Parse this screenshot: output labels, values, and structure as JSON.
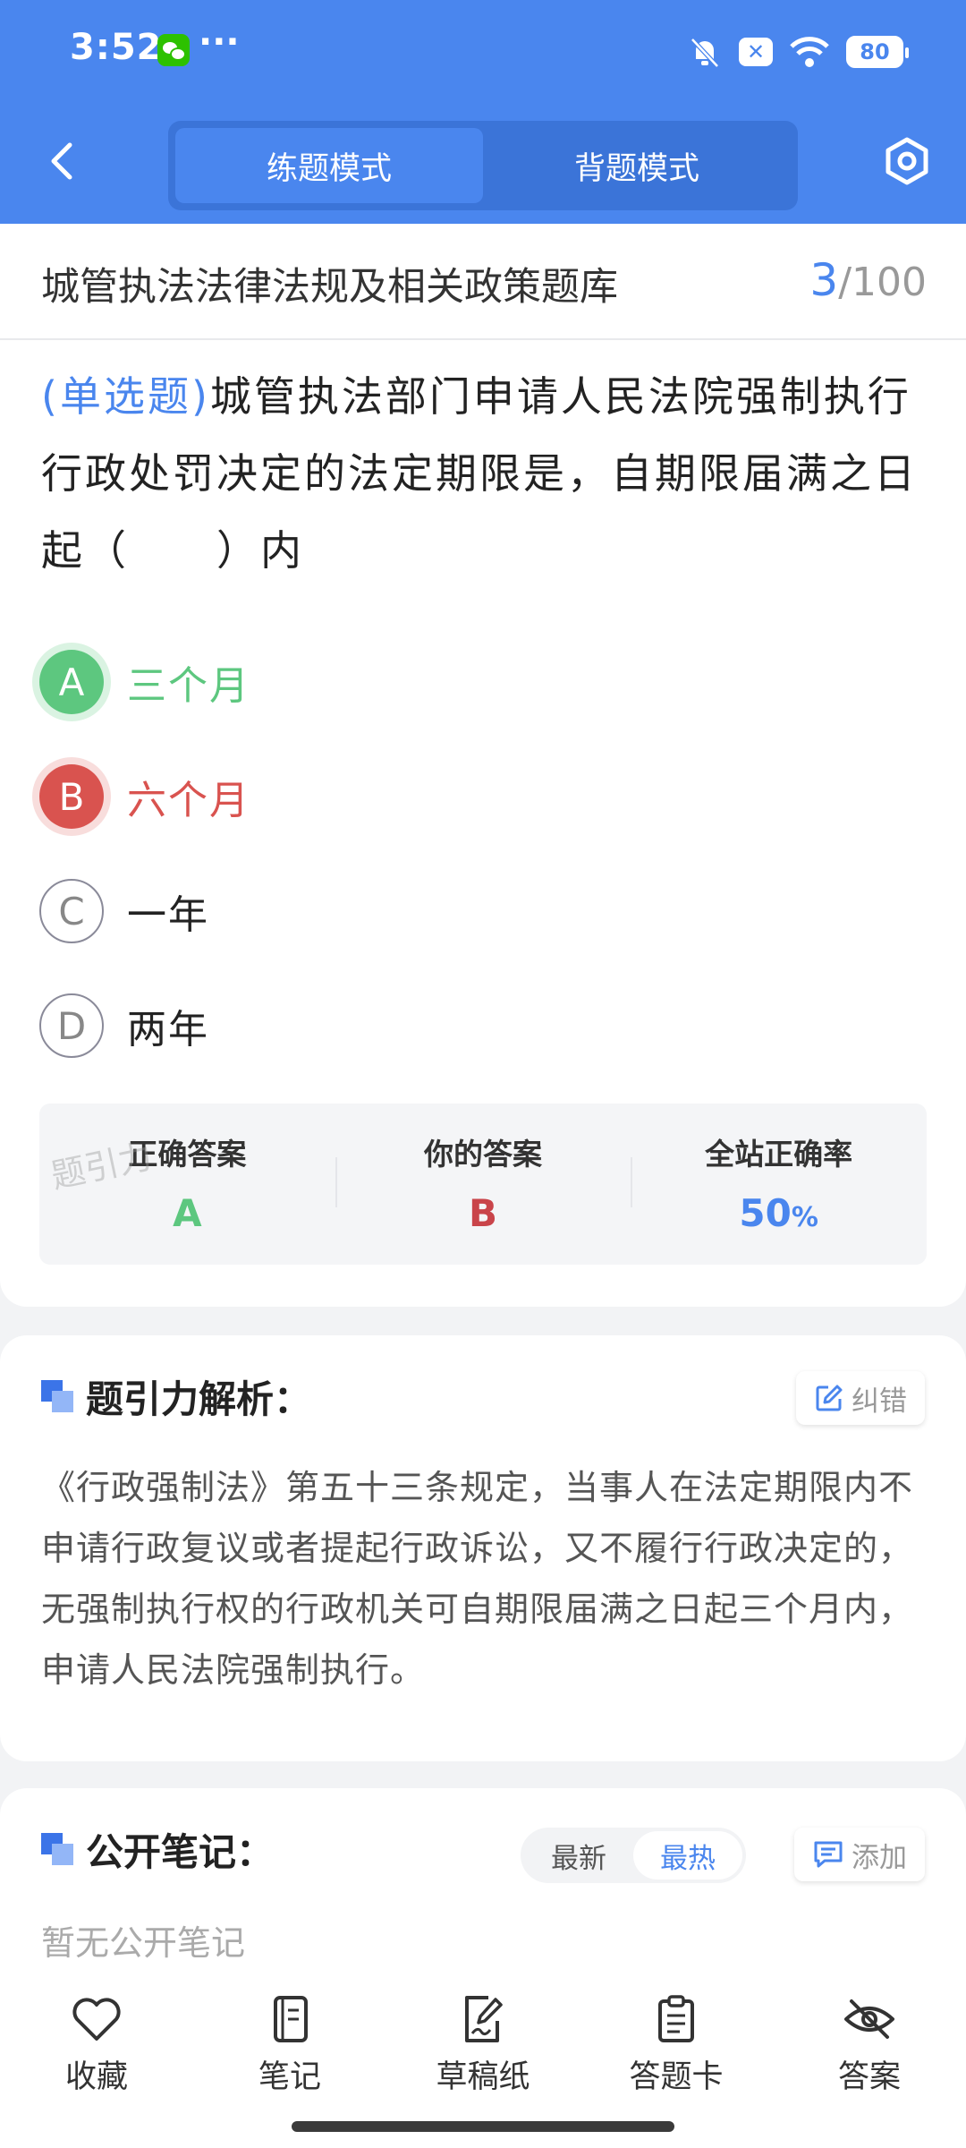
{
  "status_bar": {
    "time": "3:52",
    "dots": "···",
    "battery": "80"
  },
  "nav": {
    "mode_practice": "练题模式",
    "mode_memorize": "背题模式"
  },
  "bank": {
    "title": "城管执法法律法规及相关政策题库",
    "current": "3",
    "total": "/100"
  },
  "question": {
    "type": "(单选题)",
    "text": "城管执法部门申请人民法院强制执行行政处罚决定的法定期限是，自期限届满之日起（　　）内"
  },
  "options": [
    {
      "letter": "A",
      "text": "三个月",
      "state": "correct"
    },
    {
      "letter": "B",
      "text": "六个月",
      "state": "wrong"
    },
    {
      "letter": "C",
      "text": "一年",
      "state": "none"
    },
    {
      "letter": "D",
      "text": "两年",
      "state": "none"
    }
  ],
  "summary": {
    "correct_label": "正确答案",
    "correct_value": "A",
    "yours_label": "你的答案",
    "yours_value": "B",
    "rate_label": "全站正确率",
    "rate_value": "50",
    "rate_unit": "%"
  },
  "watermark": "题引力",
  "analysis": {
    "title": "题引力解析：",
    "report_label": "纠错",
    "text": "《行政强制法》第五十三条规定，当事人在法定期限内不申请行政复议或者提起行政诉讼，又不履行行政决定的，无强制执行权的行政机关可自期限届满之日起三个月内，申请人民法院强制执行。"
  },
  "notes": {
    "title": "公开笔记：",
    "tab_latest": "最新",
    "tab_hot": "最热",
    "add_label": "添加",
    "empty": "暂无公开笔记"
  },
  "toolbar": {
    "favorite": "收藏",
    "notes": "笔记",
    "scratch": "草稿纸",
    "answer_card": "答题卡",
    "answer": "答案"
  },
  "colors": {
    "primary": "#4a86ee",
    "correct": "#5dc77f",
    "wrong": "#d9534f"
  }
}
